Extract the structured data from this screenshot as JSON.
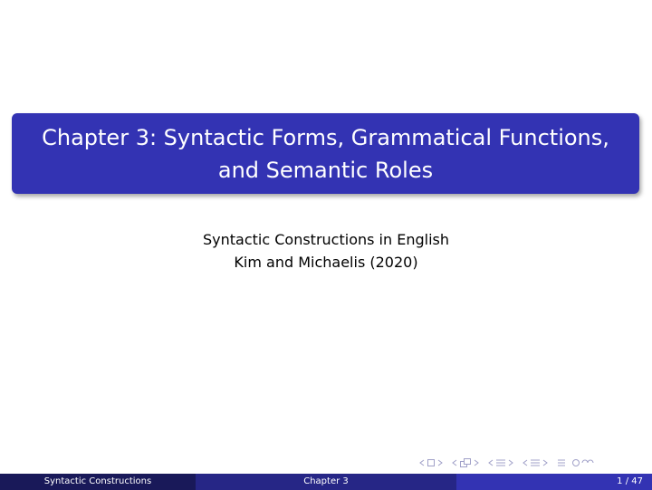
{
  "title_block": {
    "line1": "Chapter 3: Syntactic Forms, Grammatical Functions,",
    "line2": "and Semantic Roles"
  },
  "subtitle": {
    "line1": "Syntactic Constructions in English",
    "line2": "Kim and Michaelis (2020)"
  },
  "footer": {
    "left": "Syntactic Constructions",
    "center": "Chapter 3",
    "page": "1 / 47"
  },
  "colors": {
    "title_bg": "#3333b3",
    "footer_left": "#191959",
    "footer_mid": "#262686",
    "footer_right": "#3333b3"
  },
  "nav_icons": [
    "frame-prev-icon",
    "frame-icon",
    "frame-next-icon",
    "subsection-prev-icon",
    "subsection-icon",
    "subsection-next-icon",
    "section-prev-icon",
    "section-icon",
    "section-next-icon",
    "align-icon",
    "search-icon"
  ]
}
